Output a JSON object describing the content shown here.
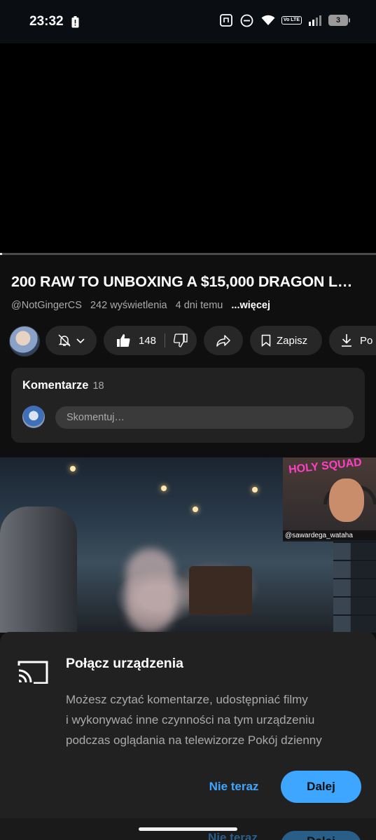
{
  "status_bar": {
    "time": "23:32",
    "battery_level": "3",
    "volte_label": "Vo LTE",
    "icons": [
      "battery-saver-icon",
      "nfc-icon",
      "do-not-disturb-icon",
      "wifi-icon",
      "volte-icon",
      "signal-icon",
      "battery-icon"
    ]
  },
  "player": {
    "progress_fraction": 0.005
  },
  "video": {
    "title": "200 RAW TO UNBOXING A $15,000 DRAGON L…",
    "channel": "@NotGingerCS",
    "views": "242 wyświetlenia",
    "age": "4 dni temu",
    "more": "...więcej"
  },
  "actions": {
    "like_count": "148",
    "save_label": "Zapisz",
    "download_label": "Po"
  },
  "comments": {
    "title": "Komentarze",
    "count": "18",
    "placeholder": "Skomentuj…"
  },
  "thumbnail": {
    "overlay_handle": "@sawardega_wataha",
    "overlay_logo_text": "HOLY SQUAD"
  },
  "cast_sheet": {
    "title": "Połącz urządzenia",
    "body_lines": [
      "Możesz czytać komentarze, udostępniać filmy",
      "i wykonywać inne czynności na tym urządzeniu",
      "podczas oglądania na telewizorze Pokój dzienny"
    ],
    "later_label": "Nie teraz",
    "next_label": "Dalej"
  },
  "colors": {
    "accent_blue": "#3ea6ff",
    "background": "#0f0f0f",
    "sheet": "#212121",
    "pill": "#272727"
  }
}
